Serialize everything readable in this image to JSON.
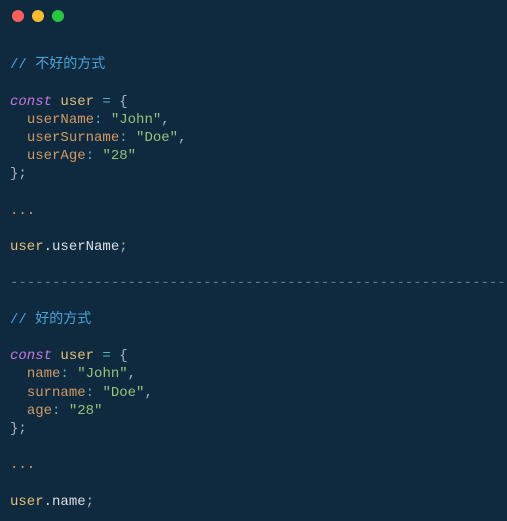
{
  "titlebar": {
    "dots": [
      "red",
      "yellow",
      "green"
    ]
  },
  "code": {
    "bad_comment": "// 不好的方式",
    "good_comment": "// 好的方式",
    "kw_const": "const",
    "var_user": "user",
    "eq": " = ",
    "brace_open": "{",
    "brace_close_semi": "};",
    "comma": ",",
    "colon": ":",
    "semi": ";",
    "dot": ".",
    "ellipsis": "...",
    "bad": {
      "p1": "userName",
      "v1": "\"John\"",
      "p2": "userSurname",
      "v2": "\"Doe\"",
      "p3": "userAge",
      "v3": "\"28\"",
      "access_prop": "userName"
    },
    "good": {
      "p1": "name",
      "v1": "\"John\"",
      "p2": "surname",
      "v2": "\"Doe\"",
      "p3": "age",
      "v3": "\"28\"",
      "access_prop": "name"
    },
    "divider": "------------------------------------------------------------"
  }
}
